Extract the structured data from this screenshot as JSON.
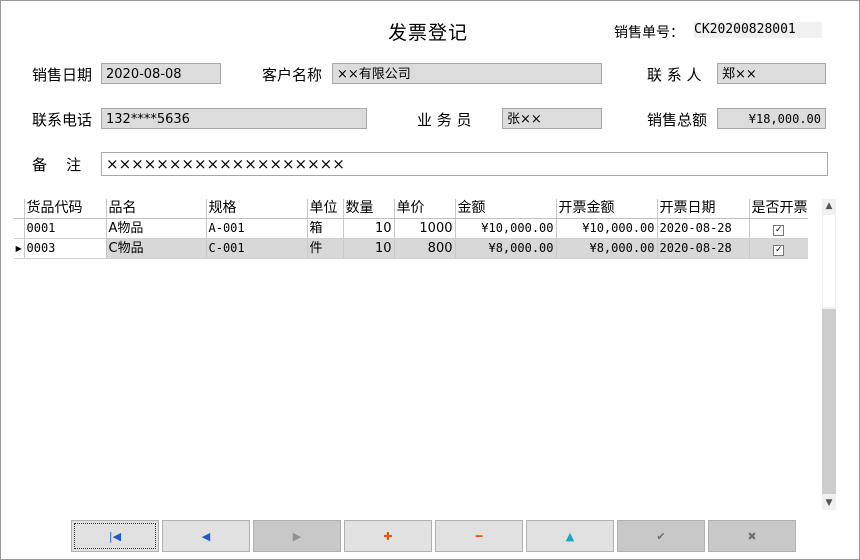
{
  "title": "发票登记",
  "sales_no_label": "销售单号：",
  "sales_no": "CK20200828001",
  "form": {
    "sale_date_label": "销售日期",
    "sale_date": "2020-08-08",
    "customer_label": "客户名称",
    "customer": "××有限公司",
    "contact_label": "联 系 人",
    "contact": "郑××",
    "phone_label": "联系电话",
    "phone": "132****5636",
    "salesman_label": "业 务 员",
    "salesman": "张××",
    "total_label": "销售总额",
    "total": "¥18,000.00",
    "remark_label": "备    注",
    "remark": "×××××××××××××××××××"
  },
  "grid": {
    "columns": [
      "货品代码",
      "品名",
      "规格",
      "单位",
      "数量",
      "单价",
      "金额",
      "开票金额",
      "开票日期",
      "是否开票"
    ],
    "rows": [
      {
        "code": "0001",
        "name": "A物品",
        "spec": "A-001",
        "unit": "箱",
        "qty": "10",
        "price": "1000",
        "amount": "¥10,000.00",
        "invoice_amount": "¥10,000.00",
        "invoice_date": "2020-08-28",
        "invoiced_mark": "✓",
        "selected": false,
        "indicator": ""
      },
      {
        "code": "0003",
        "name": "C物品",
        "spec": "C-001",
        "unit": "件",
        "qty": "10",
        "price": "800",
        "amount": "¥8,000.00",
        "invoice_amount": "¥8,000.00",
        "invoice_date": "2020-08-28",
        "invoiced_mark": "✓",
        "selected": true,
        "indicator": "▶"
      }
    ]
  },
  "scrollbar": {
    "up": "▲",
    "down": "▼"
  },
  "nav": [
    {
      "name": "first-record-button",
      "glyph": "|◀",
      "color": "#1e5cc8",
      "enabled": true
    },
    {
      "name": "prev-record-button",
      "glyph": "◀",
      "color": "#1e5cc8",
      "enabled": true
    },
    {
      "name": "next-record-button",
      "glyph": "▶",
      "color": "#909090",
      "enabled": false
    },
    {
      "name": "add-record-button",
      "glyph": "✚",
      "color": "#e05a10",
      "enabled": true
    },
    {
      "name": "delete-record-button",
      "glyph": "━",
      "color": "#e05a10",
      "enabled": true
    },
    {
      "name": "edit-record-button",
      "glyph": "▲",
      "color": "#1ea0c8",
      "enabled": true
    },
    {
      "name": "save-record-button",
      "glyph": "✔",
      "color": "#707070",
      "enabled": false
    },
    {
      "name": "cancel-record-button",
      "glyph": "✖",
      "color": "#707070",
      "enabled": false
    }
  ]
}
